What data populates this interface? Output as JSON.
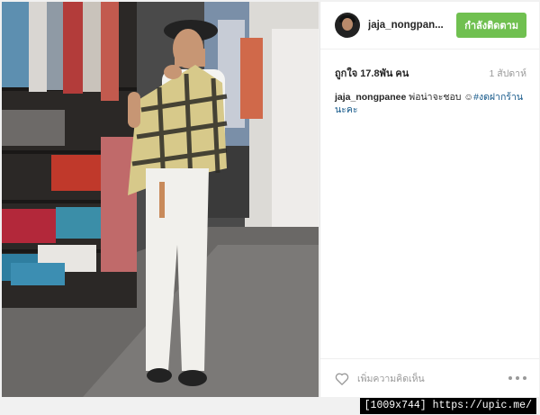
{
  "post": {
    "username": "jaja_nongpan...",
    "follow_label": "กำลังติดตาม",
    "likes": "ถูกใจ 17.8พัน คน",
    "date": "1 สัปดาห์",
    "caption_user": "jaja_nongpanee",
    "caption_text": " พ่อน่าจะชอบ ☺",
    "caption_hashtag": "#งดฝากร้านนะคะ",
    "comment_placeholder": "เพิ่มความคิดเห็น"
  },
  "watermark": "[1009x744] https://upic.me/",
  "colors": {
    "follow": "#70c050",
    "hashtag": "#125688"
  }
}
